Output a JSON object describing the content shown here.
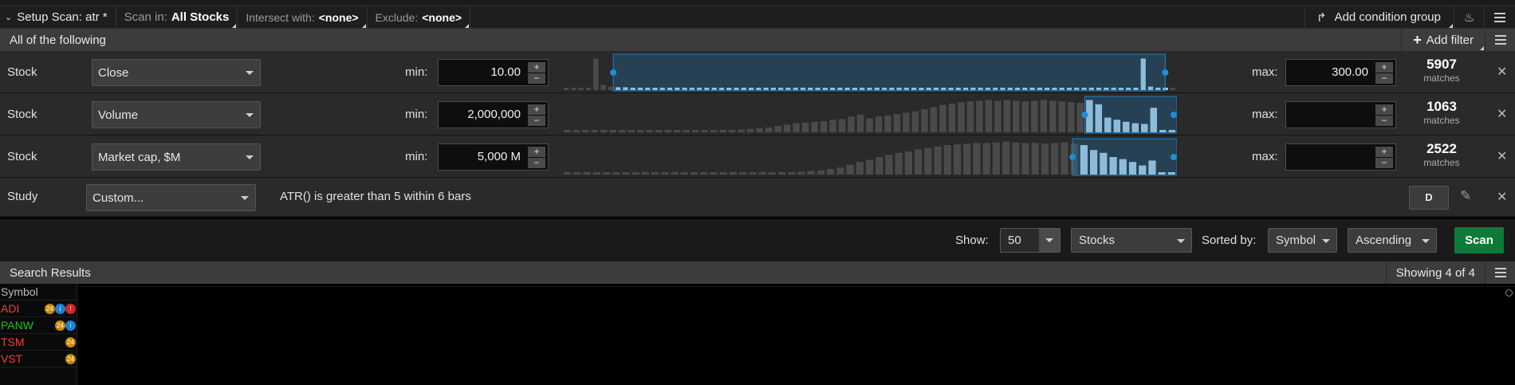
{
  "toolbar": {
    "setup_label": "Setup Scan: atr *",
    "scan_in_label": "Scan in:",
    "scan_in_value": "All Stocks",
    "intersect_label": "Intersect with:",
    "intersect_value": "<none>",
    "exclude_label": "Exclude:",
    "exclude_value": "<none>",
    "add_condition_group": "Add condition group"
  },
  "conditions_header": {
    "title": "All of the following",
    "add_filter": "Add filter"
  },
  "filters": [
    {
      "type": "Stock",
      "field": "Close",
      "min_label": "min:",
      "min": "10.00",
      "max_label": "max:",
      "max": "300.00",
      "matches": "5907",
      "matches_label": "matches",
      "range_fraction": [
        0.082,
        0.981
      ]
    },
    {
      "type": "Stock",
      "field": "Volume",
      "min_label": "min:",
      "min": "2,000,000",
      "max_label": "max:",
      "max": "",
      "matches": "1063",
      "matches_label": "matches",
      "range_fraction": [
        0.85,
        1.0
      ]
    },
    {
      "type": "Stock",
      "field": "Market cap, $M",
      "min_label": "min:",
      "min": "5,000 M",
      "max_label": "max:",
      "max": "",
      "matches": "2522",
      "matches_label": "matches",
      "range_fraction": [
        0.83,
        1.0
      ]
    }
  ],
  "study": {
    "type": "Study",
    "field": "Custom...",
    "condition": "ATR() is greater than 5 within 6 bars",
    "aggregation": "D"
  },
  "controls": {
    "show_label": "Show:",
    "show_value": "50",
    "list_value": "Stocks",
    "sorted_label": "Sorted by:",
    "sort_field": "Symbol",
    "sort_order": "Ascending",
    "scan_button": "Scan"
  },
  "results": {
    "title": "Search Results",
    "showing": "Showing 4 of 4",
    "column_header": "Symbol",
    "rows": [
      {
        "symbol": "ADI",
        "color": "#ff3b3b",
        "badges": [
          "earnings",
          "info",
          "alert"
        ]
      },
      {
        "symbol": "PANW",
        "color": "#19c419",
        "badges": [
          "earnings",
          "info"
        ]
      },
      {
        "symbol": "TSM",
        "color": "#ff3b3b",
        "badges": [
          "earnings"
        ]
      },
      {
        "symbol": "VST",
        "color": "#ff3b3b",
        "badges": [
          "earnings"
        ]
      }
    ]
  },
  "colors": {
    "accent_blue": "#1e7fc2",
    "scan_green": "#0d7a3a",
    "up_green": "#19c419",
    "down_red": "#ff3b3b"
  }
}
